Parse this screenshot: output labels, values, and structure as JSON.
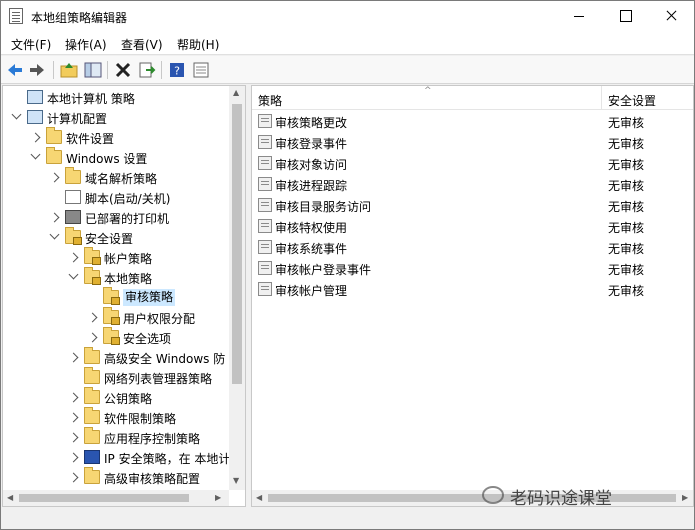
{
  "window": {
    "title": "本地组策略编辑器"
  },
  "menu": {
    "items": [
      "文件(F)",
      "操作(A)",
      "查看(V)",
      "帮助(H)"
    ]
  },
  "toolbar": {
    "icons": [
      "back-icon",
      "forward-icon",
      "up-folder-icon",
      "show-tree-icon",
      "delete-icon",
      "export-icon",
      "help-icon",
      "properties-icon"
    ]
  },
  "tree": {
    "items": [
      {
        "label": "本地计算机 策略",
        "level": 0,
        "arrow": "none",
        "icon": "computer"
      },
      {
        "label": "计算机配置",
        "level": 0,
        "arrow": "expanded",
        "icon": "computer"
      },
      {
        "label": "软件设置",
        "level": 1,
        "arrow": "collapsed",
        "icon": "folder"
      },
      {
        "label": "Windows 设置",
        "level": 1,
        "arrow": "expanded",
        "icon": "folder"
      },
      {
        "label": "域名解析策略",
        "level": 2,
        "arrow": "collapsed",
        "icon": "folder"
      },
      {
        "label": "脚本(启动/关机)",
        "level": 2,
        "arrow": "none",
        "icon": "doc"
      },
      {
        "label": "已部署的打印机",
        "level": 2,
        "arrow": "collapsed",
        "icon": "printer"
      },
      {
        "label": "安全设置",
        "level": 2,
        "arrow": "expanded",
        "icon": "lock"
      },
      {
        "label": "帐户策略",
        "level": 3,
        "arrow": "collapsed",
        "icon": "lock"
      },
      {
        "label": "本地策略",
        "level": 3,
        "arrow": "expanded",
        "icon": "lock"
      },
      {
        "label": "审核策略",
        "level": 4,
        "arrow": "none",
        "icon": "lock",
        "selected": true
      },
      {
        "label": "用户权限分配",
        "level": 4,
        "arrow": "collapsed",
        "icon": "lock"
      },
      {
        "label": "安全选项",
        "level": 4,
        "arrow": "collapsed",
        "icon": "lock"
      },
      {
        "label": "高级安全 Windows 防",
        "level": 3,
        "arrow": "collapsed",
        "icon": "folder"
      },
      {
        "label": "网络列表管理器策略",
        "level": 3,
        "arrow": "none",
        "icon": "folder"
      },
      {
        "label": "公钥策略",
        "level": 3,
        "arrow": "collapsed",
        "icon": "folder"
      },
      {
        "label": "软件限制策略",
        "level": 3,
        "arrow": "collapsed",
        "icon": "folder"
      },
      {
        "label": "应用程序控制策略",
        "level": 3,
        "arrow": "collapsed",
        "icon": "folder"
      },
      {
        "label": "IP 安全策略，在 本地计",
        "level": 3,
        "arrow": "collapsed",
        "icon": "ip"
      },
      {
        "label": "高级审核策略配置",
        "level": 3,
        "arrow": "collapsed",
        "icon": "folder"
      }
    ]
  },
  "list": {
    "headers": {
      "policy": "策略",
      "setting": "安全设置"
    },
    "rows": [
      {
        "name": "审核策略更改",
        "value": "无审核"
      },
      {
        "name": "审核登录事件",
        "value": "无审核"
      },
      {
        "name": "审核对象访问",
        "value": "无审核"
      },
      {
        "name": "审核进程跟踪",
        "value": "无审核"
      },
      {
        "name": "审核目录服务访问",
        "value": "无审核"
      },
      {
        "name": "审核特权使用",
        "value": "无审核"
      },
      {
        "name": "审核系统事件",
        "value": "无审核"
      },
      {
        "name": "审核帐户登录事件",
        "value": "无审核"
      },
      {
        "name": "审核帐户管理",
        "value": "无审核"
      }
    ]
  },
  "watermark": {
    "text": "老码识途课堂"
  }
}
